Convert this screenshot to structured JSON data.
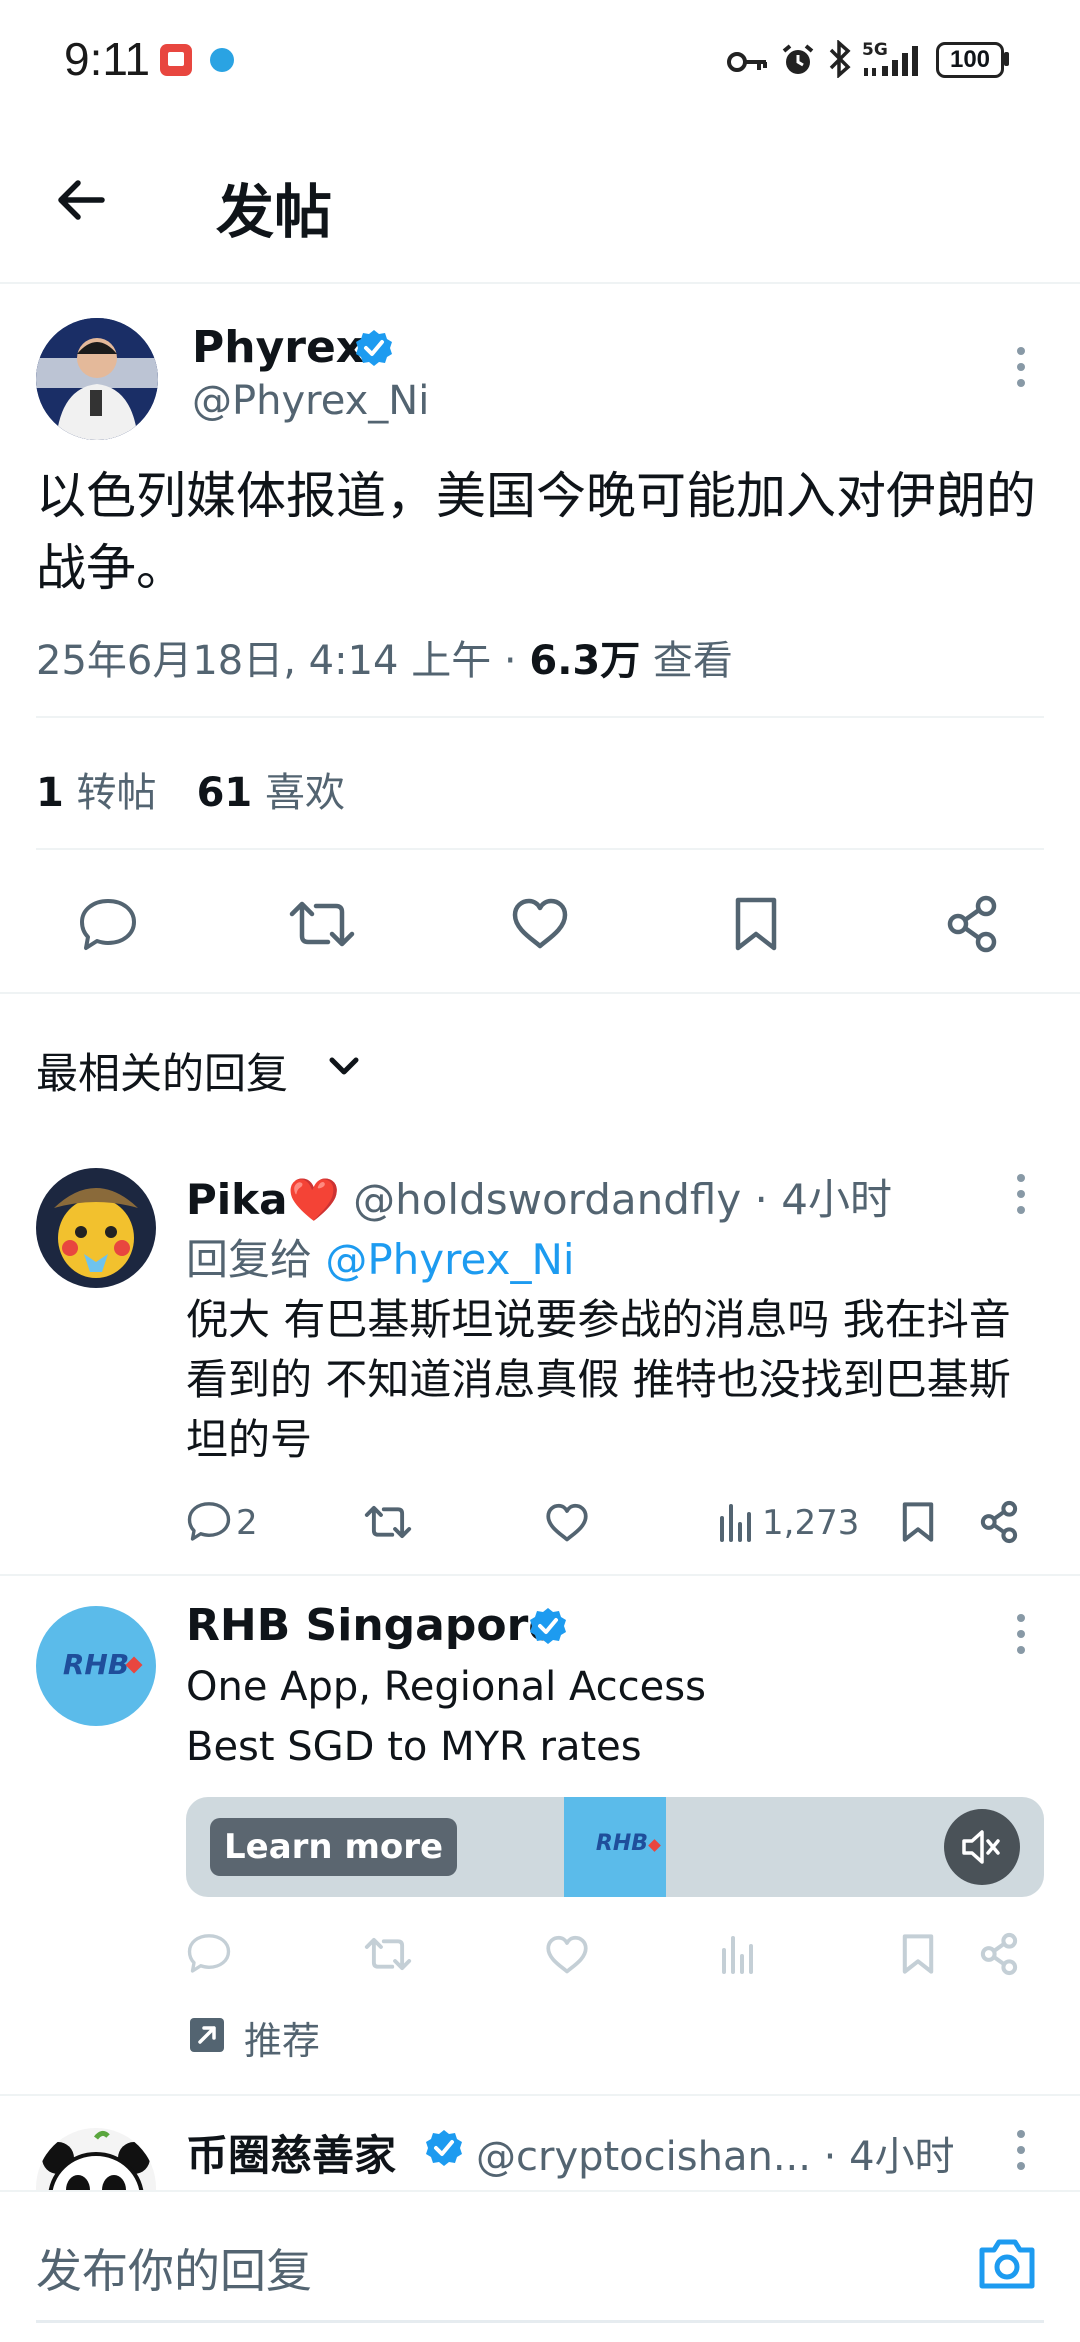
{
  "status_bar": {
    "time": "9:11",
    "network": "5G",
    "battery": "100"
  },
  "header": {
    "title": "发帖",
    "back_icon": "arrow-left-icon"
  },
  "tweet": {
    "author_name": "Phyrex",
    "author_handle": "@Phyrex_Ni",
    "text": "以色列媒体报道，美国今晚可能加入对伊朗的战争。",
    "timestamp": "25年6月18日, 4:14 上午 · ",
    "views_count": "6.3万",
    "views_label": " 查看",
    "retweets_count": "1",
    "retweets_label": " 转帖",
    "likes_count": "61",
    "likes_label": " 喜欢"
  },
  "replies_sort": {
    "label": "最相关的回复"
  },
  "reply": {
    "author_name": "Pika",
    "author_emoji": "❤️",
    "author_handle": "@holdswordandfly",
    "time": " · 4小时",
    "reply_to_prefix": "回复给 ",
    "reply_to_handle": "@Phyrex_Ni",
    "text": "倪大 有巴基斯坦说要参战的消息吗 我在抖音看到的 不知道消息真假 推特也没找到巴基斯坦的号",
    "reply_count": "2",
    "views_count": "1,273"
  },
  "ad": {
    "author_name": "RHB Singapore",
    "line1": "One App, Regional Access",
    "line2": "Best SGD to MYR rates",
    "learn_more": "Learn more",
    "logo_text": "RHB",
    "promoted_label": "推荐"
  },
  "next_reply": {
    "author_name": "币圈慈善家",
    "author_handle": "@cryptocishan...",
    "time": " · 4小时"
  },
  "reply_bar": {
    "placeholder": "发布你的回复"
  },
  "colors": {
    "accent": "#1d9bf0",
    "muted_text": "#536471",
    "heart": "#e0245e",
    "rhb_blue": "#5bbbea"
  }
}
